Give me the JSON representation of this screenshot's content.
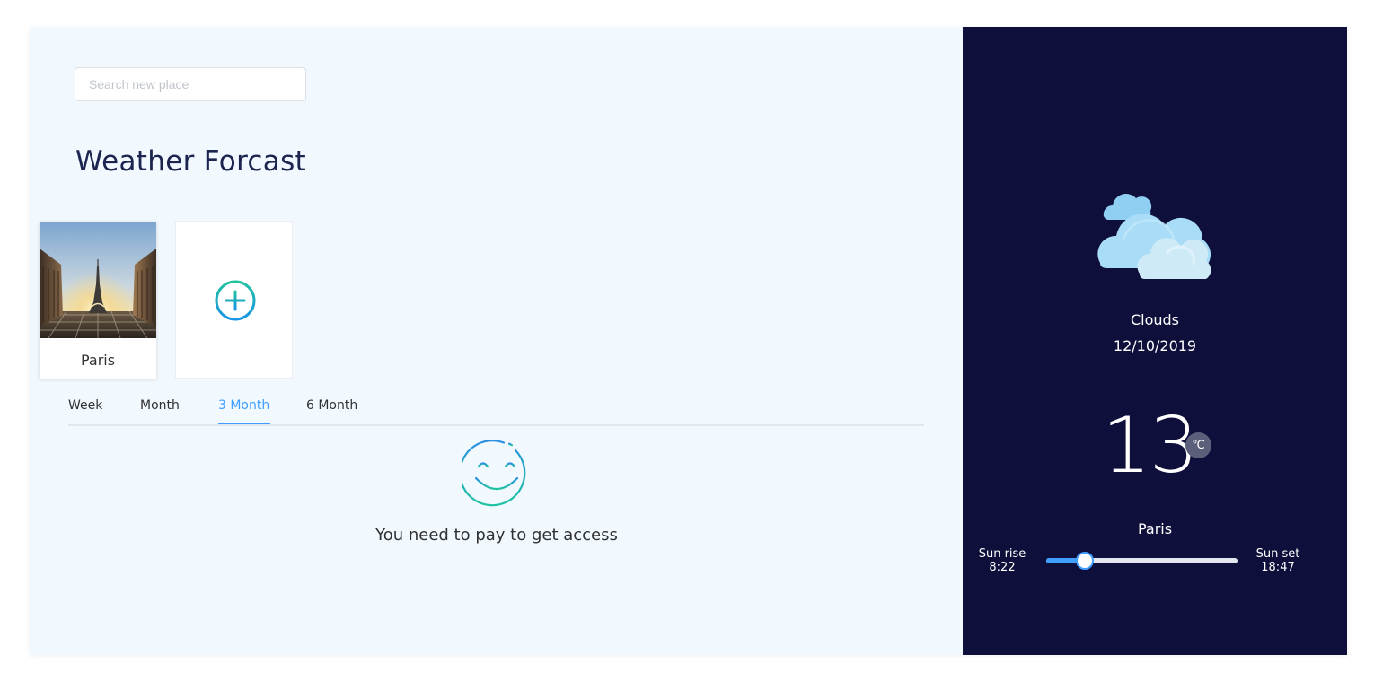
{
  "search": {
    "placeholder": "Search new place",
    "value": ""
  },
  "header": {
    "title": "Weather Forcast"
  },
  "cities": [
    {
      "name": "Paris",
      "photo": "eiffel-tower-photo"
    }
  ],
  "add_city": {
    "icon": "plus-circle-icon"
  },
  "tabs": [
    {
      "label": "Week",
      "active": false
    },
    {
      "label": "Month",
      "active": false
    },
    {
      "label": "3 Month",
      "active": true
    },
    {
      "label": "6 Month",
      "active": false
    }
  ],
  "paywall": {
    "icon": "smiley-icon",
    "message": "You need to pay to get access"
  },
  "current": {
    "icon": "clouds-icon",
    "condition": "Clouds",
    "date": "12/10/2019",
    "temperature": "13",
    "unit": "℃",
    "location": "Paris",
    "sunrise": {
      "label": "Sun rise",
      "time": "8:22"
    },
    "sunset": {
      "label": "Sun set",
      "time": "18:47"
    },
    "sun_progress_percent": 20
  },
  "colors": {
    "accent": "#409eff",
    "sidebar_bg": "#0f0f3c",
    "main_bg": "#f1f9fe",
    "title": "#1c2450",
    "gradient_start": "#20c3a0",
    "gradient_end": "#1a94e6"
  }
}
